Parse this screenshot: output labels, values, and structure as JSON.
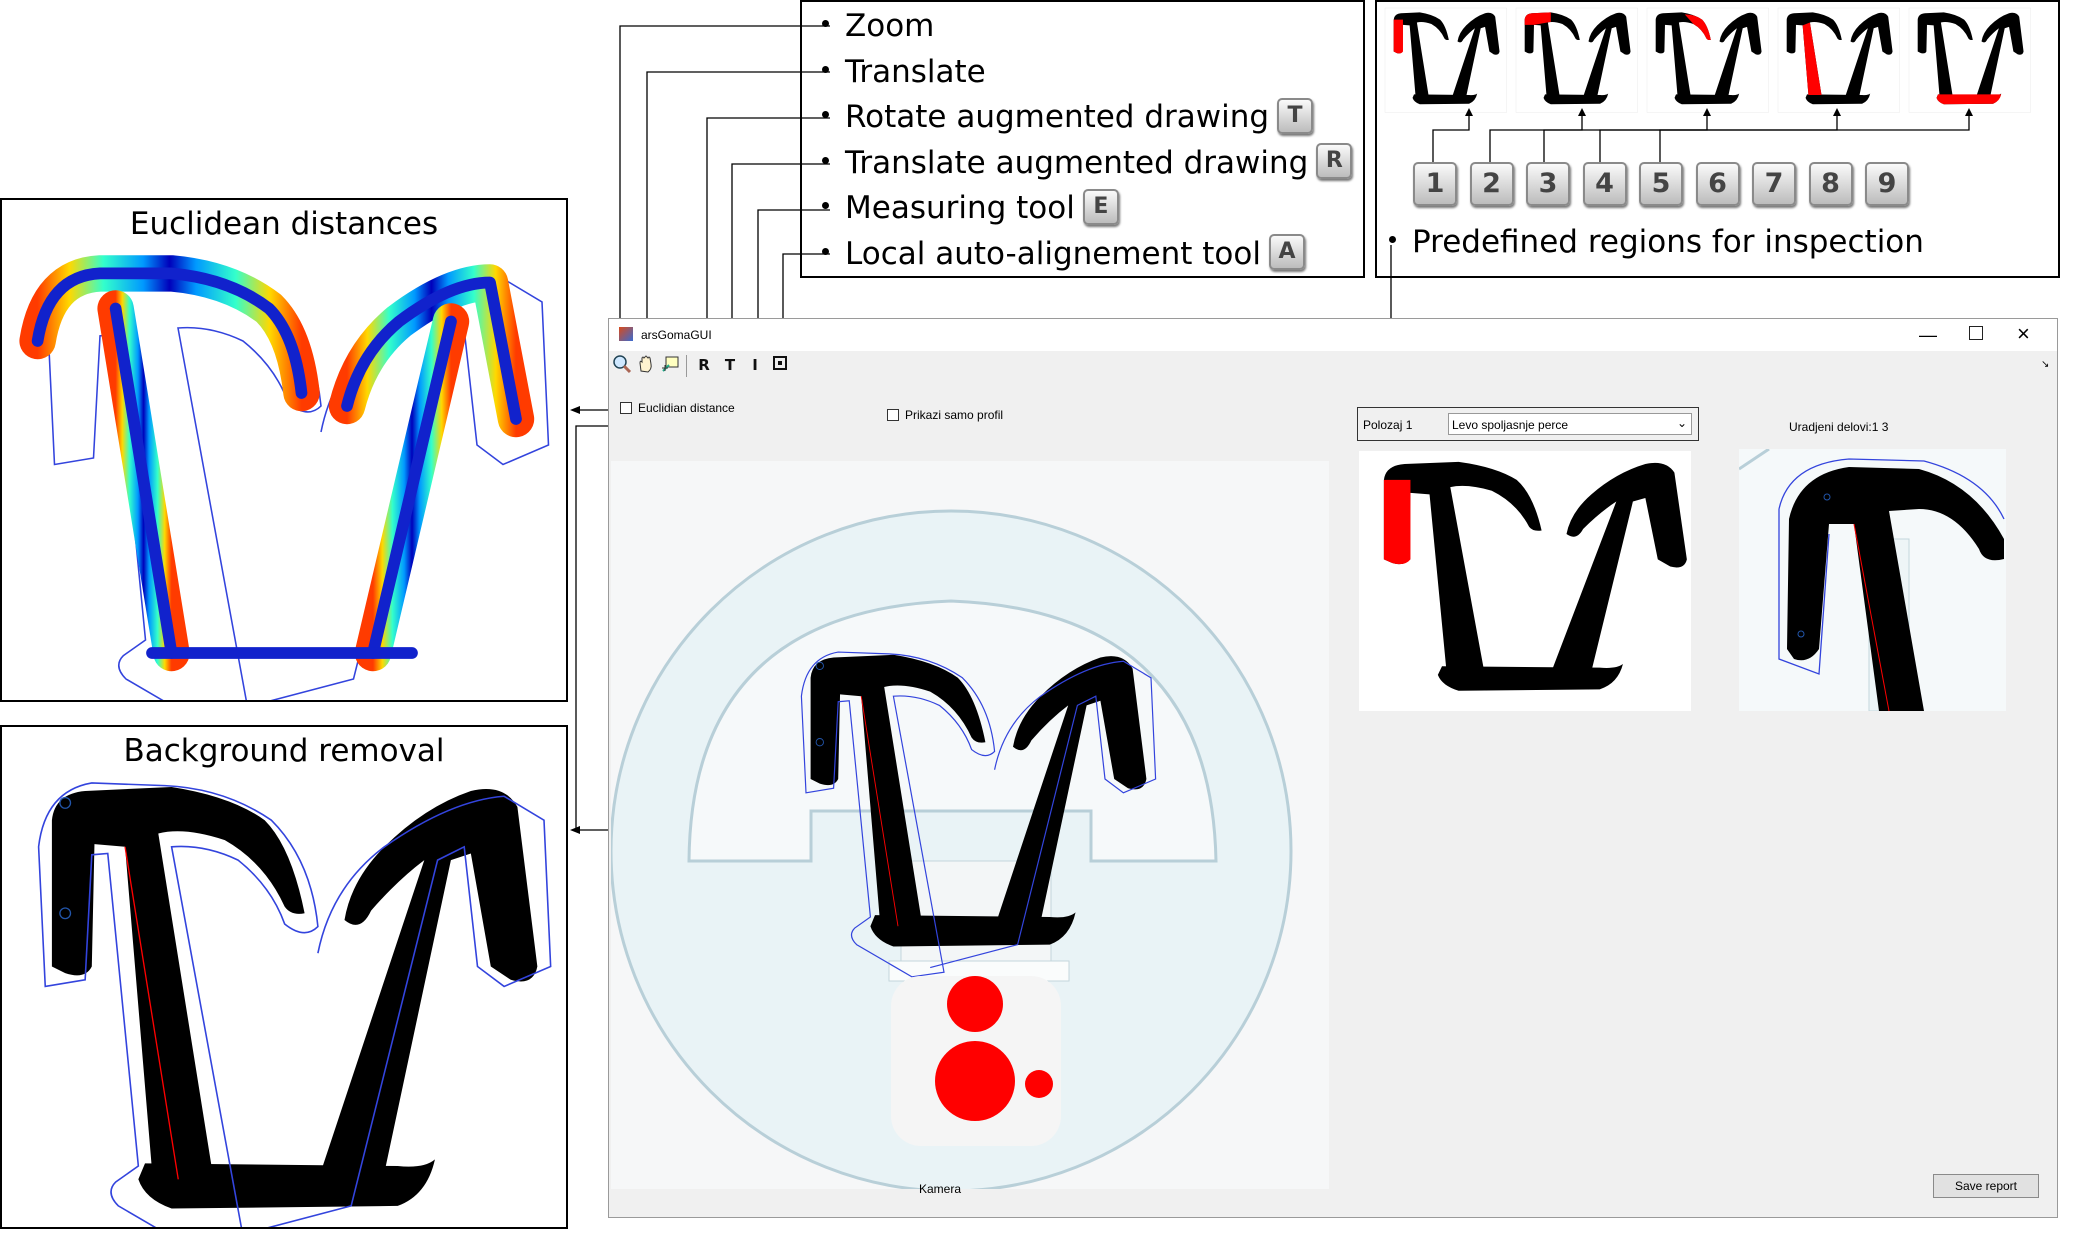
{
  "legend": {
    "items": [
      {
        "label": "Zoom",
        "key": ""
      },
      {
        "label": "Translate",
        "key": ""
      },
      {
        "label": "Rotate augmented drawing",
        "key": "T"
      },
      {
        "label": "Translate augmented drawing",
        "key": "R"
      },
      {
        "label": "Measuring tool",
        "key": "E"
      },
      {
        "label": "Local auto-alignement tool",
        "key": "A"
      }
    ]
  },
  "regions": {
    "keys": [
      "1",
      "2",
      "3",
      "4",
      "5",
      "6",
      "7",
      "8",
      "9"
    ],
    "caption": "Predefined regions for inspection"
  },
  "panels": {
    "euclidean_title": "Euclidean distances",
    "background_title": "Background removal"
  },
  "window": {
    "title": "arsGomaGUI",
    "toolbar": [
      "zoom-in-icon",
      "pan-hand-icon",
      "data-cursor-icon",
      "R",
      "T",
      "I",
      "box"
    ],
    "euclidian_checkbox": "Euclidian distance",
    "profile_checkbox": "Prikazi samo profil",
    "position_label": "Polozaj 1",
    "position_select": "Levo spoljasnje perce",
    "done_label": "Uradjeni delovi:1  3",
    "camera_label": "Kamera",
    "save_button": "Save report"
  },
  "colors": {
    "accent": "#ff0000",
    "outline": "#3344dd",
    "profile": "#000000"
  }
}
